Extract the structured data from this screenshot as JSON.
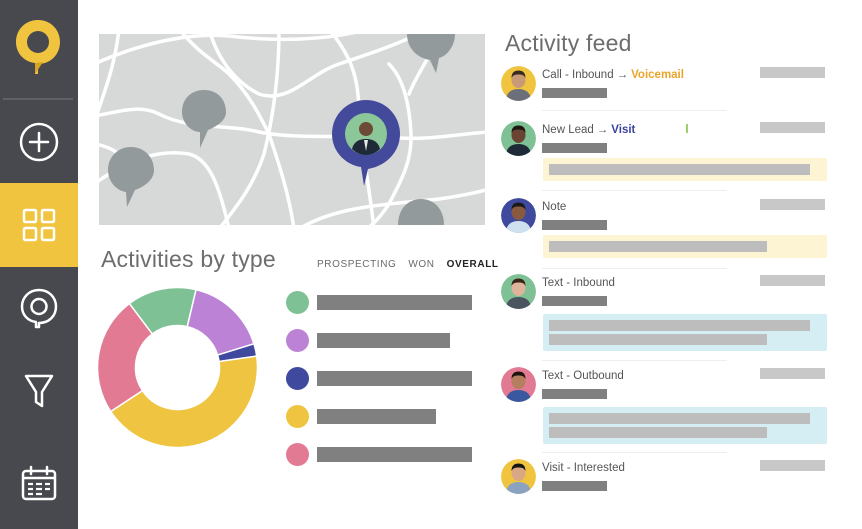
{
  "sidebar": {
    "logo": "app-logo-pin",
    "items": [
      {
        "name": "add",
        "icon": "plus-circle-icon",
        "active": false
      },
      {
        "name": "dashboard",
        "icon": "grid-icon",
        "active": true
      },
      {
        "name": "map",
        "icon": "map-pin-icon",
        "active": false
      },
      {
        "name": "funnel",
        "icon": "filter-funnel-icon",
        "active": false
      },
      {
        "name": "calendar",
        "icon": "calendar-icon",
        "active": false
      }
    ],
    "accent_color": "#f0c43f",
    "background_color": "#48494e"
  },
  "map": {
    "selected_pin_color": "#444a9b",
    "pin_color": "#939a9b",
    "pins": 5
  },
  "activities_by_type": {
    "title": "Activities by type",
    "filters": [
      "PROSPECTING",
      "WON",
      "OVERALL"
    ],
    "active_filter": "OVERALL"
  },
  "chart_data": {
    "type": "pie",
    "variant": "donut",
    "title": "Activities by type",
    "slices": [
      {
        "color": "#7ec194",
        "share": 0.14
      },
      {
        "color": "#bb82d6",
        "share": 0.165
      },
      {
        "color": "#3f4a9e",
        "share": 0.025
      },
      {
        "color": "#efc441",
        "share": 0.43
      },
      {
        "color": "#e27a93",
        "share": 0.24
      }
    ],
    "legend": [
      {
        "color": "#7ec194",
        "bar_fraction": 1.0
      },
      {
        "color": "#bb82d6",
        "bar_fraction": 0.86
      },
      {
        "color": "#3f4a9e",
        "bar_fraction": 1.0
      },
      {
        "color": "#efc441",
        "bar_fraction": 0.77
      },
      {
        "color": "#e27a93",
        "bar_fraction": 1.0
      }
    ],
    "legend_placement": "right"
  },
  "activity_feed": {
    "title": "Activity feed",
    "items": [
      {
        "label": "Call - Inbound",
        "outcome": "Voicemail",
        "outcome_color": "#e8a52a",
        "avatar_bg": "#f0c43f",
        "note": null
      },
      {
        "label": "New Lead",
        "outcome": "Visit",
        "outcome_color": "#3b43a0",
        "avatar_bg": "#7ec194",
        "note": {
          "style": "yellow",
          "lines": [
            0.96
          ]
        }
      },
      {
        "label": "Note",
        "outcome": null,
        "avatar_bg": "#3f4a9e",
        "note": {
          "style": "yellow",
          "lines": [
            0.8
          ]
        }
      },
      {
        "label": "Text - Inbound",
        "outcome": null,
        "avatar_bg": "#7ec194",
        "note": {
          "style": "blue",
          "lines": [
            0.96,
            0.8
          ]
        }
      },
      {
        "label": "Text - Outbound",
        "outcome": null,
        "avatar_bg": "#e27a93",
        "note": {
          "style": "blue",
          "lines": [
            0.96,
            0.8
          ]
        }
      },
      {
        "label": "Visit - Interested",
        "outcome": null,
        "avatar_bg": "#f0c43f",
        "note": null
      }
    ],
    "arrow": "→"
  }
}
